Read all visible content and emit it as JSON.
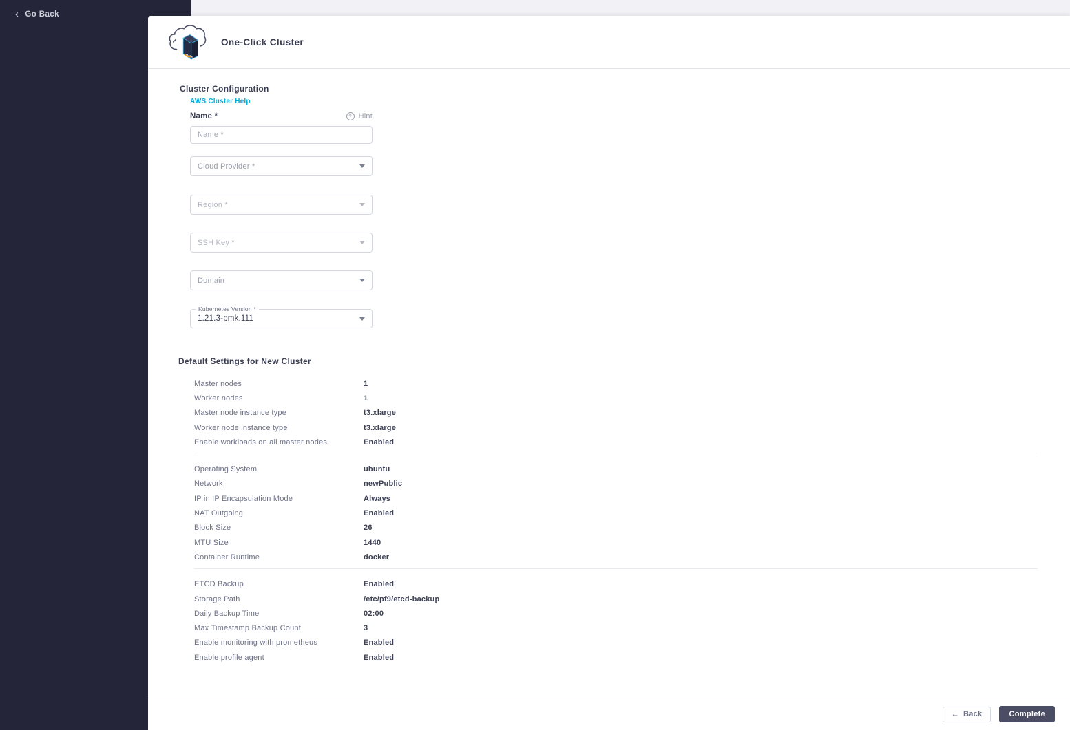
{
  "sidebar": {
    "go_back": "Go Back"
  },
  "header": {
    "title": "One-Click Cluster"
  },
  "icons": {
    "go_back_chevron": "‹",
    "back_arrow": "←",
    "hint_glyph": "?"
  },
  "cluster_config": {
    "section_title": "Cluster Configuration",
    "help_link": "AWS Cluster Help",
    "name_label": "Name *",
    "hint_label": "Hint",
    "name_placeholder": "Name *",
    "cloud_provider_placeholder": "Cloud Provider *",
    "region_placeholder": "Region *",
    "ssh_key_placeholder": "SSH Key *",
    "domain_placeholder": "Domain",
    "kubernetes_label": "Kubernetes Version *",
    "kubernetes_value": "1.21.3-pmk.111"
  },
  "default_settings": {
    "section_title": "Default Settings for New Cluster",
    "groups": [
      {
        "rows": [
          {
            "label": "Master nodes",
            "value": "1"
          },
          {
            "label": "Worker nodes",
            "value": "1"
          },
          {
            "label": "Master node instance type",
            "value": "t3.xlarge"
          },
          {
            "label": "Worker node instance type",
            "value": "t3.xlarge"
          },
          {
            "label": "Enable workloads on all master nodes",
            "value": "Enabled"
          }
        ]
      },
      {
        "rows": [
          {
            "label": "Operating System",
            "value": "ubuntu"
          },
          {
            "label": "Network",
            "value": "newPublic"
          },
          {
            "label": "IP in IP Encapsulation Mode",
            "value": "Always"
          },
          {
            "label": "NAT Outgoing",
            "value": "Enabled"
          },
          {
            "label": "Block Size",
            "value": "26"
          },
          {
            "label": "MTU Size",
            "value": "1440"
          },
          {
            "label": "Container Runtime",
            "value": "docker"
          }
        ]
      },
      {
        "rows": [
          {
            "label": "ETCD Backup",
            "value": "Enabled"
          },
          {
            "label": "Storage Path",
            "value": "/etc/pf9/etcd-backup"
          },
          {
            "label": "Daily Backup Time",
            "value": "02:00"
          },
          {
            "label": "Max Timestamp Backup Count",
            "value": "3"
          },
          {
            "label": "Enable monitoring with prometheus",
            "value": "Enabled"
          },
          {
            "label": "Enable profile agent",
            "value": "Enabled"
          }
        ]
      }
    ]
  },
  "footer": {
    "back": "Back",
    "complete": "Complete"
  },
  "colors": {
    "sidebar_bg": "#25253a",
    "accent_link": "#00abde",
    "primary_button_bg": "#4a4d63",
    "aws_box_edge": "#38b6e8",
    "aws_smile": "#f79400"
  }
}
